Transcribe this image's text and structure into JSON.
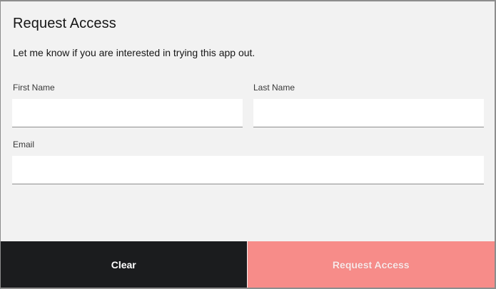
{
  "modal": {
    "title": "Request Access",
    "subtitle": "Let me know if you are interested in trying this app out."
  },
  "form": {
    "first_name": {
      "label": "First Name",
      "value": ""
    },
    "last_name": {
      "label": "Last Name",
      "value": ""
    },
    "email": {
      "label": "Email",
      "value": ""
    }
  },
  "footer": {
    "clear_label": "Clear",
    "submit_label": "Request Access"
  },
  "colors": {
    "modal_bg": "#f2f2f2",
    "clear_button": "#1b1c1e",
    "submit_button": "#f78c89"
  }
}
